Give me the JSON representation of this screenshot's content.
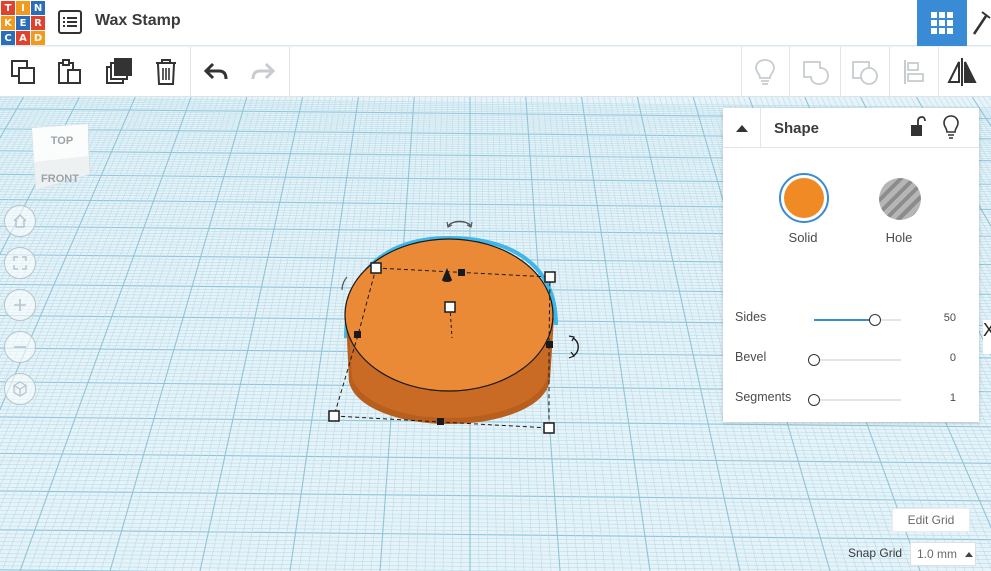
{
  "app": {
    "logo_letters": [
      "T",
      "I",
      "N",
      "K",
      "E",
      "R",
      "C",
      "A",
      "D"
    ],
    "logo_colors": [
      "#e2412c",
      "#f29a1d",
      "#2a6ebb",
      "#f29a1d",
      "#2a6ebb",
      "#e2412c",
      "#2a6ebb",
      "#e2412c",
      "#f29a1d"
    ],
    "project_title": "Wax Stamp",
    "menu_icon": "list-icon",
    "grid_view_icon": "grid-view-icon",
    "accent_color": "#3a8bd6"
  },
  "toolbar": {
    "buttons": [
      {
        "name": "copy-button",
        "icon": "copy-icon",
        "enabled": true
      },
      {
        "name": "paste-button",
        "icon": "paste-icon",
        "enabled": true
      },
      {
        "name": "duplicate-button",
        "icon": "duplicate-icon",
        "enabled": true
      },
      {
        "name": "delete-button",
        "icon": "trash-icon",
        "enabled": true
      },
      {
        "name": "undo-button",
        "icon": "undo-icon",
        "enabled": true
      },
      {
        "name": "redo-button",
        "icon": "redo-icon",
        "enabled": false
      },
      {
        "name": "notes-button",
        "icon": "lightbulb-icon",
        "enabled": false
      },
      {
        "name": "group-button",
        "icon": "group-icon",
        "enabled": false
      },
      {
        "name": "ungroup-button",
        "icon": "ungroup-icon",
        "enabled": false
      },
      {
        "name": "align-button",
        "icon": "align-icon",
        "enabled": false
      },
      {
        "name": "mirror-button",
        "icon": "mirror-icon",
        "enabled": true
      }
    ]
  },
  "viewcube": {
    "top_label": "TOP",
    "front_label": "FRONT"
  },
  "nav": [
    "home-icon",
    "fit-view-icon",
    "zoom-in-icon",
    "zoom-out-icon",
    "perspective-icon"
  ],
  "shape_panel": {
    "title": "Shape",
    "solid_label": "Solid",
    "hole_label": "Hole",
    "solid_color": "#f08a24",
    "properties": [
      {
        "label": "Sides",
        "value": "50",
        "fraction": 0.7
      },
      {
        "label": "Bevel",
        "value": "0",
        "fraction": 0.0
      },
      {
        "label": "Segments",
        "value": "1",
        "fraction": 0.0
      }
    ]
  },
  "grid": {
    "edit_label": "Edit Grid",
    "snap_label": "Snap Grid",
    "snap_value": "1.0 mm"
  },
  "edge_glyph": "X"
}
